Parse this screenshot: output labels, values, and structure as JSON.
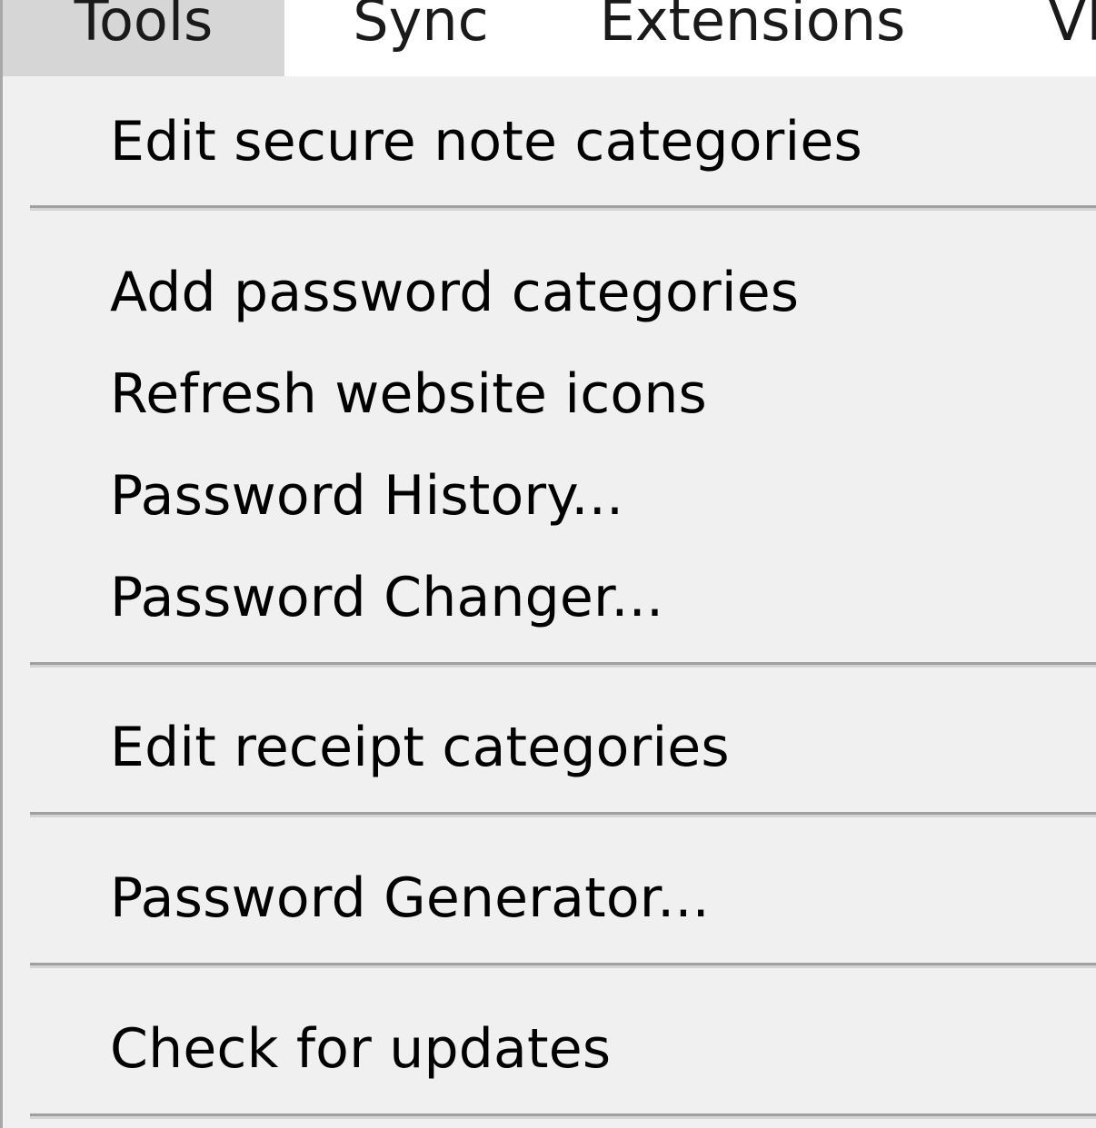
{
  "menubar": {
    "menus": [
      {
        "label": "Tools",
        "active": true
      },
      {
        "label": "Sync",
        "active": false
      },
      {
        "label": "Extensions",
        "active": false
      },
      {
        "label": "VP",
        "active": false
      }
    ]
  },
  "tools_menu": {
    "items": [
      {
        "label": "Edit secure note categories"
      },
      {
        "label": "Add password categories"
      },
      {
        "label": "Refresh website icons"
      },
      {
        "label": "Password History..."
      },
      {
        "label": "Password Changer..."
      },
      {
        "label": "Edit receipt categories"
      },
      {
        "label": "Password Generator..."
      },
      {
        "label": "Check for updates"
      }
    ]
  },
  "colors": {
    "menu_background": "#f0f0f0",
    "active_menu_highlight": "#d6d6d6",
    "separator": "#a0a0a0"
  }
}
